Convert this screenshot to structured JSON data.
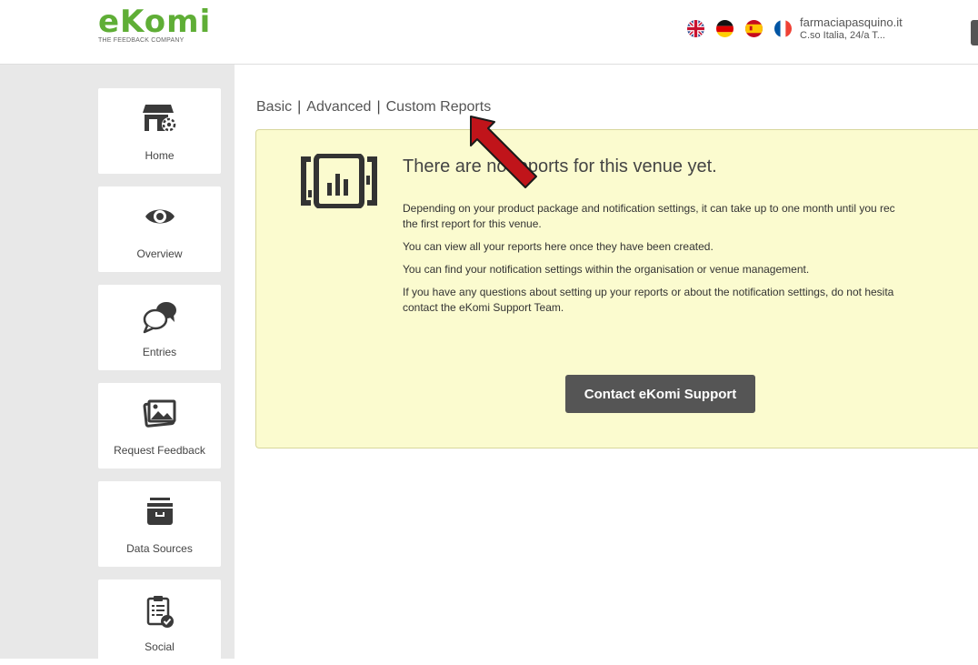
{
  "brand": {
    "name": "eKomi",
    "tagline": "THE FEEDBACK COMPANY",
    "color": "#5fae36"
  },
  "languages": [
    {
      "code": "en",
      "icon": "uk-flag-icon"
    },
    {
      "code": "de",
      "icon": "germany-flag-icon"
    },
    {
      "code": "es",
      "icon": "spain-flag-icon"
    },
    {
      "code": "fr",
      "icon": "france-flag-icon"
    }
  ],
  "venue": {
    "name": "farmaciapasquino.it",
    "address": "C.so Italia, 24/a T..."
  },
  "sidebar": {
    "items": [
      {
        "label": "Home",
        "icon": "shop-settings-icon"
      },
      {
        "label": "Overview",
        "icon": "eye-icon"
      },
      {
        "label": "Entries",
        "icon": "chat-bubbles-icon"
      },
      {
        "label": "Request Feedback",
        "icon": "images-icon"
      },
      {
        "label": "Data Sources",
        "icon": "archive-box-icon"
      },
      {
        "label": "Social",
        "icon": "clipboard-check-icon"
      }
    ]
  },
  "report_tabs": [
    "Basic",
    "Advanced",
    "Custom Reports"
  ],
  "notice": {
    "title": "There are no reports for this venue yet.",
    "paragraphs": [
      "Depending on your product package and notification settings, it can take up to one month until you rec",
      "the first report for this venue.",
      "You can view all your reports here once they have been created.",
      "You can find your notification settings within the organisation or venue management.",
      "If you have any questions about setting up your reports or about the notification settings, do not hesita",
      "contact the eKomi Support Team."
    ],
    "button_label": "Contact eKomi Support",
    "icon": "report-chart-icon"
  },
  "annotation": {
    "icon": "red-arrow-icon",
    "color": "#c0141a"
  },
  "colors": {
    "notice_bg": "#fbfbcf",
    "sidebar_bg": "#e8e8e8",
    "button_bg": "#555555"
  }
}
